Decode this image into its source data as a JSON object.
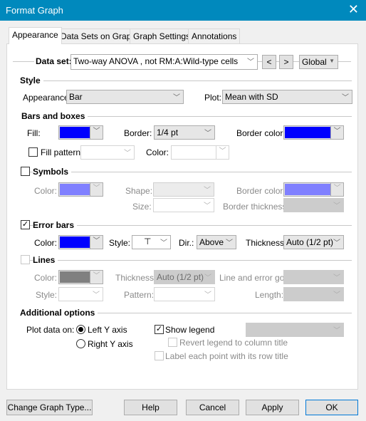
{
  "window": {
    "title": "Format Graph",
    "close_icon": "close-icon"
  },
  "tabs": [
    {
      "label": "Appearance",
      "active": true
    },
    {
      "label": "Data Sets on Graph"
    },
    {
      "label": "Graph Settings"
    },
    {
      "label": "Annotations"
    }
  ],
  "dataset": {
    "label": "Data set:",
    "value": "Two-way ANOVA , not RM:A:Wild-type cells",
    "prev": "<",
    "next": ">",
    "scope": "Global"
  },
  "style": {
    "header": "Style",
    "appearance_label": "Appearance:",
    "appearance_value": "Bar",
    "plot_label": "Plot:",
    "plot_value": "Mean with SD"
  },
  "bars": {
    "header": "Bars and boxes",
    "fill_label": "Fill:",
    "fill_color": "#0000ff",
    "border_label": "Border:",
    "border_value": "1/4 pt",
    "border_color_label": "Border color:",
    "border_color": "#0000ff",
    "fill_pattern_label": "Fill pattern",
    "fill_pattern_checked": false,
    "color_label": "Color:"
  },
  "symbols": {
    "header": "Symbols",
    "checked": false,
    "color_label": "Color:",
    "color": "#8080ff",
    "shape_label": "Shape:",
    "size_label": "Size:",
    "border_color_label": "Border color:",
    "border_color": "#8080ff",
    "border_thickness_label": "Border thickness:"
  },
  "error_bars": {
    "header": "Error bars",
    "checked": true,
    "color_label": "Color:",
    "color": "#0000ff",
    "style_label": "Style:",
    "style_glyph": "⊤",
    "dir_label": "Dir.:",
    "dir_value": "Above",
    "thickness_label": "Thickness:",
    "thickness_value": "Auto (1/2 pt)"
  },
  "lines": {
    "header": "Lines",
    "checked": false,
    "color_label": "Color:",
    "color": "#808080",
    "thickness_label": "Thickness:",
    "thickness_value": "Auto (1/2 pt)",
    "line_error_label": "Line and error go:",
    "style_label": "Style:",
    "pattern_label": "Pattern:",
    "length_label": "Length:"
  },
  "additional": {
    "header": "Additional options",
    "plot_on_label": "Plot data on:",
    "left_axis": "Left Y axis",
    "right_axis": "Right  Y axis",
    "left_selected": true,
    "show_legend": "Show legend",
    "show_legend_checked": true,
    "revert_legend": "Revert legend to column title",
    "label_point": "Label each point with its row title"
  },
  "buttons": {
    "change_type": "Change Graph Type...",
    "help": "Help",
    "cancel": "Cancel",
    "apply": "Apply",
    "ok": "OK"
  }
}
